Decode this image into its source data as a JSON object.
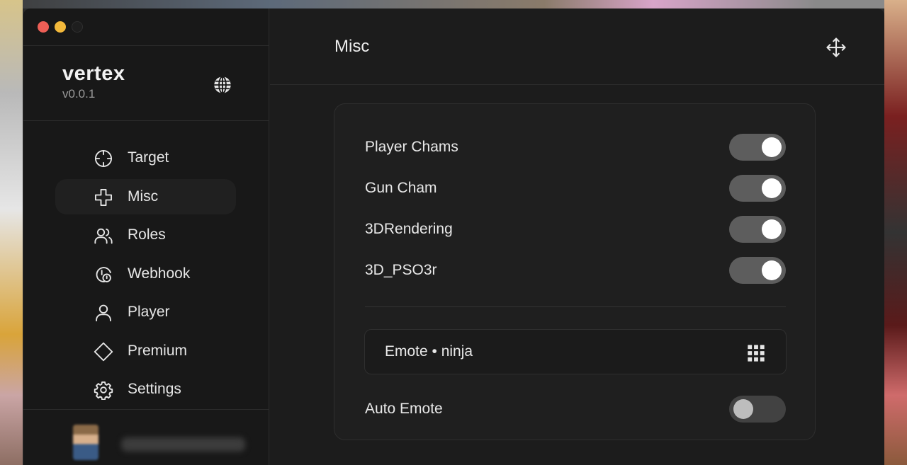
{
  "app": {
    "title": "vertex",
    "version": "v0.0.1"
  },
  "nav": {
    "items": [
      {
        "label": "Target",
        "icon": "crosshair-icon",
        "active": false
      },
      {
        "label": "Misc",
        "icon": "plus-icon",
        "active": true
      },
      {
        "label": "Roles",
        "icon": "users-icon",
        "active": false
      },
      {
        "label": "Webhook",
        "icon": "webhook-icon",
        "active": false
      },
      {
        "label": "Player",
        "icon": "user-icon",
        "active": false
      },
      {
        "label": "Premium",
        "icon": "diamond-icon",
        "active": false
      },
      {
        "label": "Settings",
        "icon": "gear-icon",
        "active": false
      }
    ]
  },
  "main": {
    "title": "Misc",
    "toggles": [
      {
        "label": "Player Chams",
        "on": true
      },
      {
        "label": "Gun Cham",
        "on": true
      },
      {
        "label": "3DRendering",
        "on": true
      },
      {
        "label": "3D_PSO3r",
        "on": true
      }
    ],
    "dropdown": {
      "label": "Emote • ninja"
    },
    "auto_emote": {
      "label": "Auto Emote",
      "on": false
    }
  },
  "colors": {
    "window_bg": "#1c1c1c",
    "sidebar_bg": "#181818",
    "toggle_on": "#5d5d5d",
    "toggle_off": "#424242",
    "close": "#ed5f56",
    "minimize": "#f3b93b"
  }
}
